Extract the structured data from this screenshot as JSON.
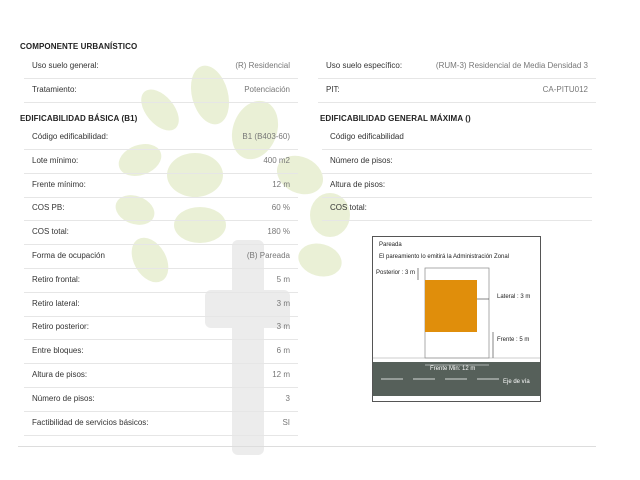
{
  "component": {
    "title": "COMPONENTE URBANÍSTICO",
    "rows": [
      {
        "label": "Uso suelo general:",
        "value": "(R) Residencial"
      },
      {
        "label": "Tratamiento:",
        "value": "Potenciación"
      }
    ],
    "rows_right": [
      {
        "label": "Uso suelo específico:",
        "value": "(RUM-3) Residencial de Media Densidad 3"
      },
      {
        "label": "PIT:",
        "value": "CA-PITU012"
      }
    ]
  },
  "basic": {
    "title": "EDIFICABILIDAD BÁSICA (B1)",
    "rows": [
      {
        "label": "Código edificabilidad:",
        "value": "B1 (B403-60)"
      },
      {
        "label": "Lote mínimo:",
        "value": "400 m2"
      },
      {
        "label": "Frente mínimo:",
        "value": "12 m"
      },
      {
        "label": "COS PB:",
        "value": "60 %"
      },
      {
        "label": "COS total:",
        "value": "180 %"
      },
      {
        "label": "Forma de ocupación",
        "value": "(B) Pareada"
      },
      {
        "label": "Retiro frontal:",
        "value": "5 m"
      },
      {
        "label": "Retiro lateral:",
        "value": "3 m"
      },
      {
        "label": "Retiro posterior:",
        "value": "3 m"
      },
      {
        "label": "Entre bloques:",
        "value": "6 m"
      },
      {
        "label": "Altura de pisos:",
        "value": "12 m"
      },
      {
        "label": "Número de pisos:",
        "value": "3"
      },
      {
        "label": "Factibilidad de servicios básicos:",
        "value": "SI"
      }
    ]
  },
  "max": {
    "title": "EDIFICABILIDAD GENERAL MÁXIMA ()",
    "rows": [
      {
        "label": "Código edificabilidad",
        "value": ""
      },
      {
        "label": "Número de pisos:",
        "value": ""
      },
      {
        "label": "Altura de pisos:",
        "value": ""
      },
      {
        "label": "COS total:",
        "value": ""
      }
    ]
  },
  "diagram": {
    "title": "Pareada",
    "note": "El pareamiento lo emitirá la Administración Zonal",
    "posterior": "Posterior : 3 m",
    "lateral": "Lateral : 3 m",
    "frente": "Frente : 5 m",
    "frente_min": "Frente Min: 12 m",
    "eje": "Eje de vía",
    "building_color": "#e08e0b",
    "road_color": "#56605a"
  },
  "colors": {
    "watermark": "#dfe8c4"
  }
}
